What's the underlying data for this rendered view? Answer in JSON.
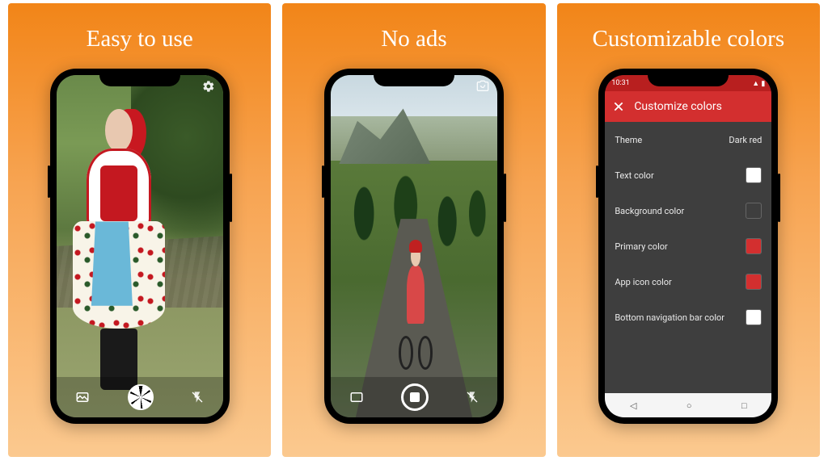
{
  "panels": [
    {
      "title": "Easy to use"
    },
    {
      "title": "No ads"
    },
    {
      "title": "Customizable colors"
    }
  ],
  "settings": {
    "status_time": "10:31",
    "header": "Customize colors",
    "rows": [
      {
        "label": "Theme",
        "value": "Dark red"
      },
      {
        "label": "Text color",
        "swatch": "sw-white"
      },
      {
        "label": "Background color",
        "swatch": "sw-dark"
      },
      {
        "label": "Primary color",
        "swatch": "sw-red"
      },
      {
        "label": "App icon color",
        "swatch": "sw-red"
      },
      {
        "label": "Bottom navigation bar color",
        "swatch": "sw-white"
      }
    ]
  },
  "colors": {
    "accent": "#d32f2f",
    "panel_bg": "#3e3e3e"
  }
}
